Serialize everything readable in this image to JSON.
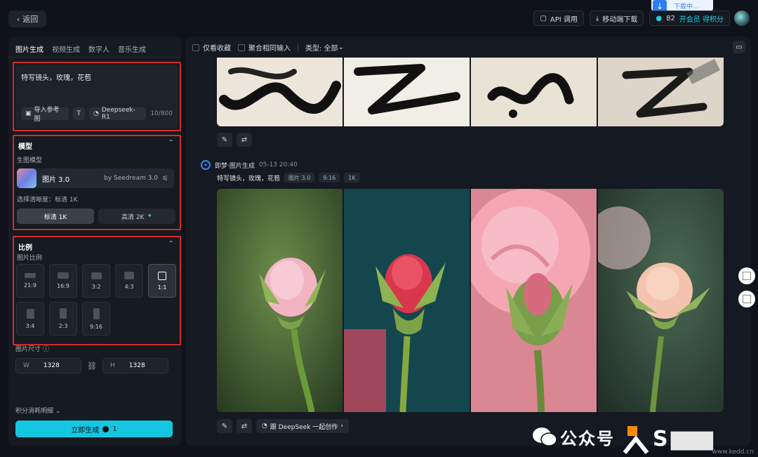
{
  "topbar": {
    "back_label": "返回",
    "download_toast": "下载中...",
    "api_label": "API 调用",
    "mobile_label": "移动端下载",
    "credits": "82",
    "vip_label": "开会员 得积分"
  },
  "left": {
    "tabs": [
      "图片生成",
      "视频生成",
      "数字人",
      "音乐生成"
    ],
    "prompt_text": "特写镜头，玫瑰，花苞",
    "ref_image_label": "导入参考图",
    "deepseek_label": "Deepseek-R1",
    "counter": "10/800",
    "model_section_title": "模型",
    "model_sub_label": "生图模型",
    "model_name": "图片 3.0",
    "model_by": "by Seedream 3.0",
    "clarity_label": "选择清晰度：标清 1K",
    "res_standard": "标清 1K",
    "res_hd": "高清 2K",
    "ratio_section_title": "比例",
    "ratio_sub_label": "图片比例",
    "ratios": [
      {
        "label": "21:9",
        "active": false
      },
      {
        "label": "16:9",
        "active": false
      },
      {
        "label": "3:2",
        "active": false
      },
      {
        "label": "4:3",
        "active": false
      },
      {
        "label": "1:1",
        "active": true
      },
      {
        "label": "3:4",
        "active": false
      },
      {
        "label": "2:3",
        "active": false
      },
      {
        "label": "9:16",
        "active": false
      }
    ],
    "size_label": "图片尺寸",
    "width_prefix": "W",
    "width_value": "1328",
    "height_prefix": "H",
    "height_value": "1328",
    "cost_detail": "积分消耗明细",
    "generate_label": "立即生成",
    "generate_cost": "1"
  },
  "main": {
    "filter_favorites": "仅看收藏",
    "filter_aggregate": "聚合相同输入",
    "filter_type": "类型: 全部",
    "gen_meta_title": "即梦·图片生成",
    "gen_meta_time": "05-13  20:40",
    "gen_prompt": "特写镜头，玫瑰，花苞",
    "gen_tags": [
      "图片 3.0",
      "9:16",
      "1K"
    ],
    "deepseek_collab": "跟 DeepSeek 一起创作"
  },
  "watermark": {
    "text": "公众号",
    "site": "www.kedd.cn"
  },
  "colors": {
    "accent": "#15c6e0",
    "highlight_border": "#d12b2b"
  }
}
